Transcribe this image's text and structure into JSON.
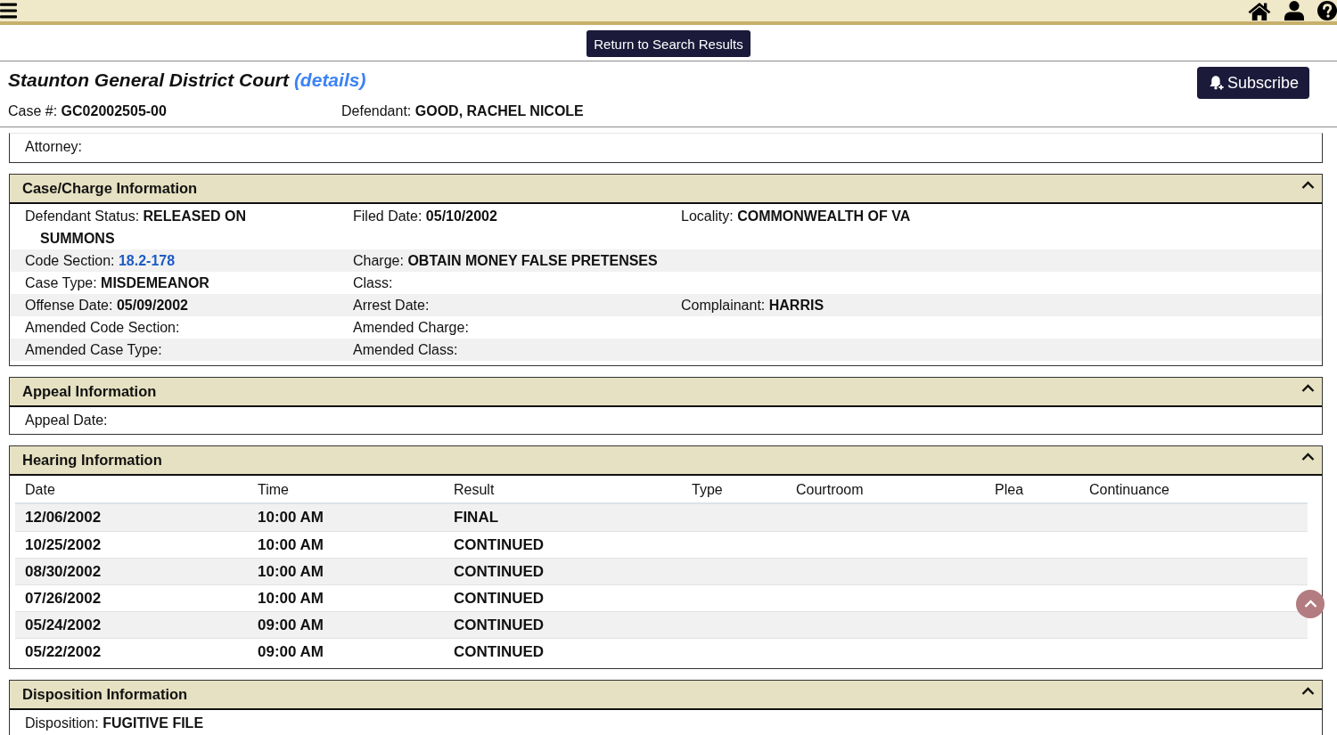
{
  "return_button": "Return to Search Results",
  "court": {
    "name": "Staunton General District Court",
    "details_link": "(details)"
  },
  "subscribe_button": "Subscribe",
  "case_summary": [
    {
      "label": "Case #:",
      "value": "GC02002505-00"
    },
    {
      "label": "Defendant:",
      "value": "GOOD, RACHEL NICOLE"
    }
  ],
  "sections": [
    {
      "kind": "fields",
      "rows": [
        [
          {
            "label": "Attorney:"
          }
        ]
      ]
    },
    {
      "kind": "fields",
      "title": "Case/Charge Information",
      "expanded": true,
      "rows": [
        [
          {
            "label": "Defendant Status:",
            "value": "RELEASED ON SUMMONS"
          },
          {
            "label": "Filed Date:",
            "value": "05/10/2002"
          },
          {
            "label": "Locality:",
            "value": "COMMONWEALTH OF VA"
          }
        ],
        [
          {
            "label": "Code Section:",
            "link": "18.2-178"
          },
          {
            "label": "Charge:",
            "value": "OBTAIN MONEY FALSE PRETENSES"
          },
          null
        ],
        [
          {
            "label": "Case Type:",
            "value": "MISDEMEANOR"
          },
          {
            "label": "Class:"
          },
          null
        ],
        [
          {
            "label": "Offense Date:",
            "value": "05/09/2002"
          },
          {
            "label": "Arrest Date:"
          },
          {
            "label": "Complainant:",
            "value": "HARRIS"
          }
        ],
        [
          {
            "label": "Amended Code Section:"
          },
          {
            "label": "Amended Charge:"
          },
          null
        ],
        [
          {
            "label": "Amended Case Type:"
          },
          {
            "label": "Amended Class:"
          },
          null
        ]
      ]
    },
    {
      "kind": "fields",
      "title": "Appeal Information",
      "expanded": true,
      "rows": [
        [
          {
            "label": "Appeal Date:"
          }
        ]
      ]
    },
    {
      "kind": "table",
      "title": "Hearing Information",
      "expanded": true,
      "columns": [
        "Date",
        "Time",
        "Result",
        "Type",
        "Courtroom",
        "Plea",
        "Continuance"
      ],
      "rows": [
        [
          "12/06/2002",
          "10:00 AM",
          "FINAL"
        ],
        [
          "10/25/2002",
          "10:00 AM",
          "CONTINUED"
        ],
        [
          "08/30/2002",
          "10:00 AM",
          "CONTINUED"
        ],
        [
          "07/26/2002",
          "10:00 AM",
          "CONTINUED"
        ],
        [
          "05/24/2002",
          "09:00 AM",
          "CONTINUED"
        ],
        [
          "05/22/2002",
          "09:00 AM",
          "CONTINUED"
        ]
      ]
    },
    {
      "kind": "fields",
      "title": "Disposition Information",
      "expanded": true,
      "rows": [
        [
          {
            "label": "Disposition:",
            "value": "FUGITIVE FILE"
          }
        ]
      ]
    }
  ]
}
